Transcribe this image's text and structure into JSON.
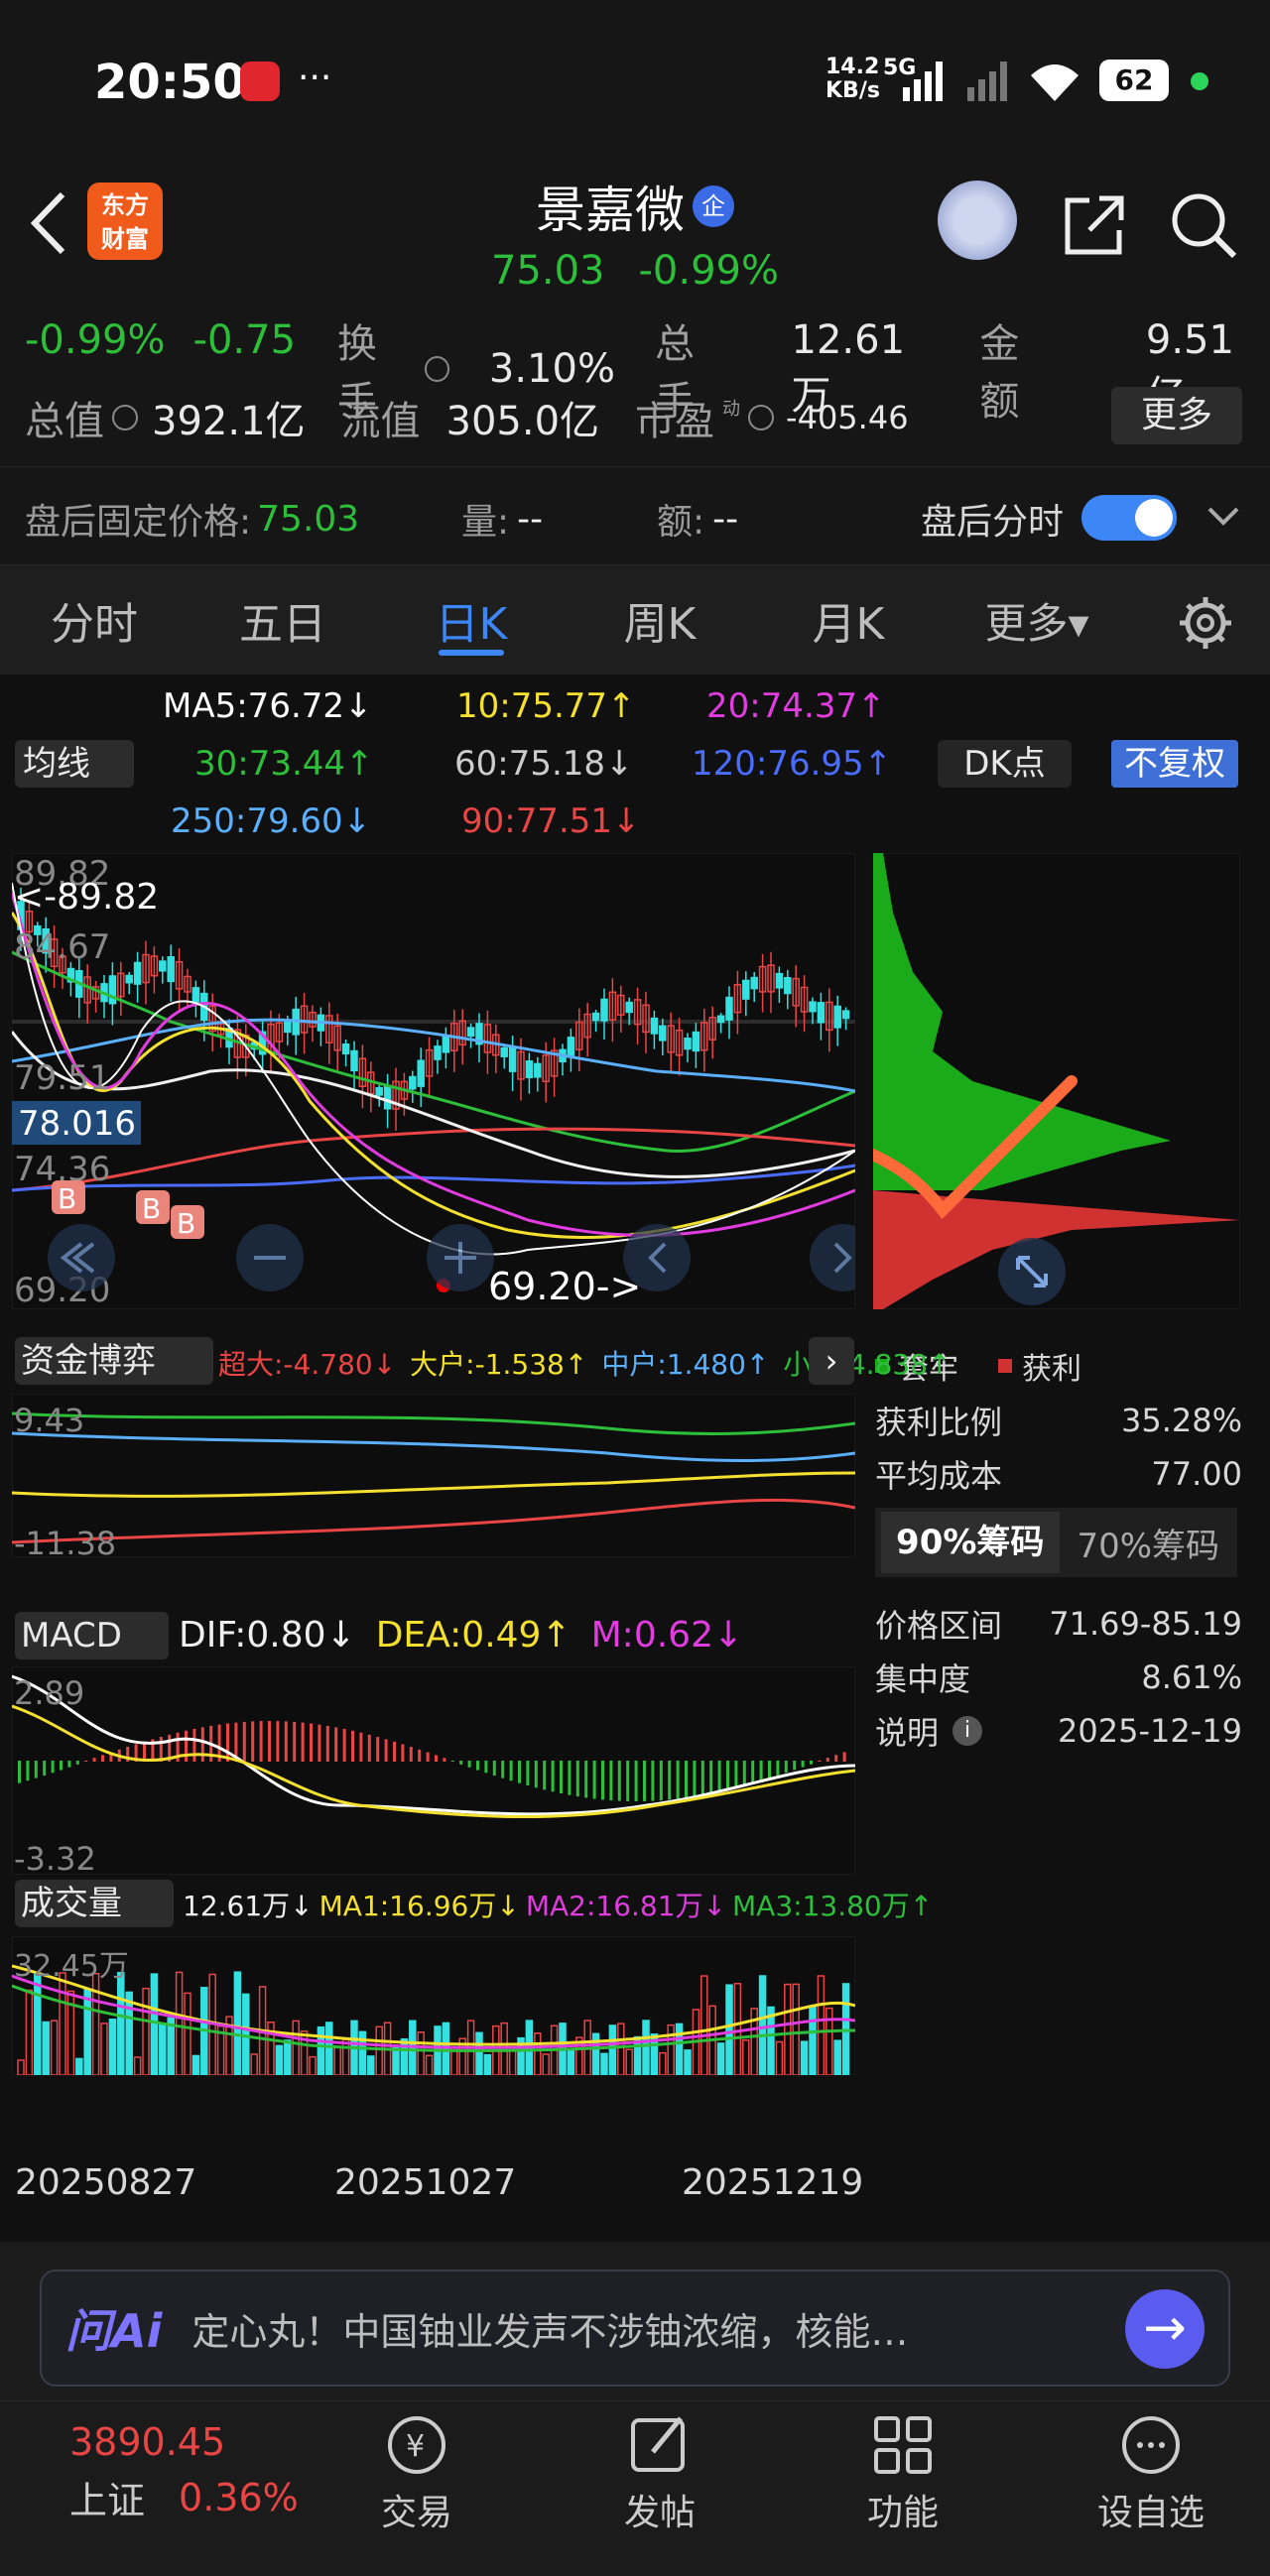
{
  "status": {
    "time": "20:50",
    "dots": "···",
    "net_speed": "14.2",
    "net_unit": "KB/s",
    "net_type": "5G",
    "battery": "62"
  },
  "header": {
    "name": "景嘉微",
    "badge": "企",
    "price": "75.03",
    "change_pct": "-0.99%",
    "logo_line1": "东方",
    "logo_line2": "财富"
  },
  "quote": {
    "change_pct": "-0.99%",
    "change": "-0.75",
    "turnover_label": "换手",
    "turnover": "3.10%",
    "volume_label": "总手",
    "volume": "12.61万",
    "amount_label": "金额",
    "amount": "9.51亿",
    "mktcap_label": "总值",
    "mktcap": "392.1亿",
    "float_label": "流值",
    "float": "305.0亿",
    "pe_label": "市盈",
    "pe_sup": "动",
    "pe": "-405.46",
    "more_label": "更多"
  },
  "after_hours": {
    "price_label": "盘后固定价格:",
    "price": "75.03",
    "vol_label": "量:",
    "vol": "--",
    "amt_label": "额:",
    "amt": "--",
    "toggle_label": "盘后分时"
  },
  "tabs": [
    "分时",
    "五日",
    "日K",
    "周K",
    "月K",
    "更多▾"
  ],
  "ma": {
    "button": "均线",
    "ma5": "MA5:76.72↓",
    "ma10": "10:75.77↑",
    "ma20": "20:74.37↑",
    "ma30": "30:73.44↑",
    "ma60": "60:75.18↓",
    "ma120": "120:76.95↑",
    "ma250": "250:79.60↓",
    "ma90": "90:77.51↓",
    "dk": "DK点",
    "fq": "不复权"
  },
  "kline": {
    "high_label": "89.82",
    "high_mark": "<-89.82",
    "y2": "84.67",
    "y3": "79.51",
    "y4": "74.36",
    "cur": "78.016",
    "low_label": "69.20",
    "low_mark": "69.20->",
    "b": "B"
  },
  "chips": {
    "legend_trap": "套牢",
    "legend_profit": "获利",
    "profit_ratio_label": "获利比例",
    "profit_ratio": "35.28%",
    "avg_cost_label": "平均成本",
    "avg_cost": "77.00",
    "tab90": "90%筹码",
    "tab70": "70%筹码",
    "range_label": "价格区间",
    "range": "71.69-85.19",
    "concentration_label": "集中度",
    "concentration": "8.61%",
    "note_label": "说明",
    "note": "2025-12-19"
  },
  "fund": {
    "button": "资金博弈",
    "super": "超大:-4.780↓",
    "big": "大户:-1.538↑",
    "mid": "中户:1.480↑",
    "small": "小户:4.838↑",
    "top": "9.43",
    "bottom": "-11.38"
  },
  "macd": {
    "button": "MACD",
    "dif": "DIF:0.80↓",
    "dea": "DEA:0.49↑",
    "m": "M:0.62↓",
    "top": "2.89",
    "bottom": "-3.32"
  },
  "vol": {
    "button": "成交量",
    "v": "12.61万↓",
    "ma1": "MA1:16.96万↓",
    "ma2": "MA2:16.81万↓",
    "ma3": "MA3:13.80万↑",
    "top": "32.45万"
  },
  "dates": [
    "20250827",
    "20251027",
    "20251219"
  ],
  "ai": {
    "logo": "问Ai",
    "text": "定心丸！中国铀业发声不涉铀浓缩，核能…"
  },
  "nav": {
    "index_value": "3890.45",
    "index_name": "上证",
    "index_pct": "0.36%",
    "items": [
      "交易",
      "发帖",
      "功能",
      "设自选"
    ]
  }
}
